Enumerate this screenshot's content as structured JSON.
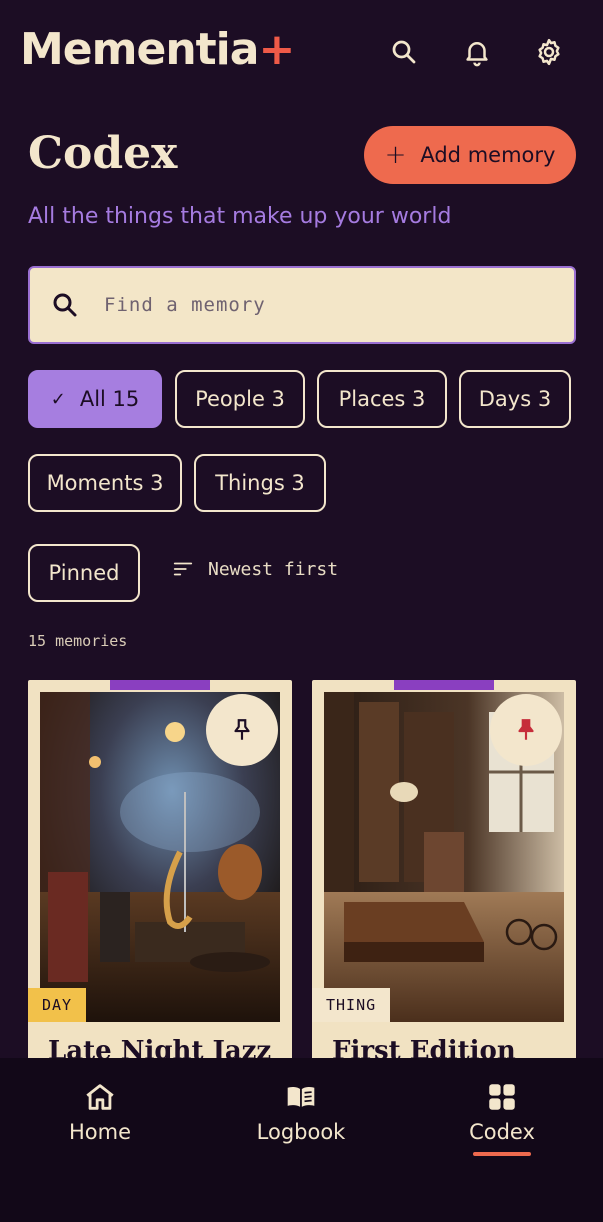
{
  "app": {
    "logo_text": "Mementia",
    "logo_plus": "+",
    "accent": "#ee6a4e",
    "highlight": "#a67ee0",
    "background": "#1c0d24"
  },
  "header": {
    "icons": [
      "search-icon",
      "bell-icon",
      "gear-icon"
    ]
  },
  "page": {
    "title": "Codex",
    "subtitle": "All the things that make up your world",
    "add_button": "Add memory"
  },
  "search": {
    "placeholder": "Find a memory",
    "value": ""
  },
  "filters": [
    {
      "label": "All 15",
      "active": true
    },
    {
      "label": "People 3",
      "active": false
    },
    {
      "label": "Places 3",
      "active": false
    },
    {
      "label": "Days 3",
      "active": false
    },
    {
      "label": "Moments 3",
      "active": false
    },
    {
      "label": "Things 3",
      "active": false
    }
  ],
  "pinned_chip": "Pinned",
  "sort": {
    "label": "Newest first"
  },
  "count_text": "15 memories",
  "cards": [
    {
      "tag": "DAY",
      "tag_color": "#f2c14a",
      "title": "Late Night Jazz",
      "pinned": false
    },
    {
      "tag": "THING",
      "tag_color": "#f3e6cc",
      "title": "First Edition",
      "pinned": true
    }
  ],
  "nav": [
    {
      "label": "Home",
      "icon": "home-icon",
      "active": false
    },
    {
      "label": "Logbook",
      "icon": "book-icon",
      "active": false
    },
    {
      "label": "Codex",
      "icon": "grid-icon",
      "active": true
    }
  ]
}
